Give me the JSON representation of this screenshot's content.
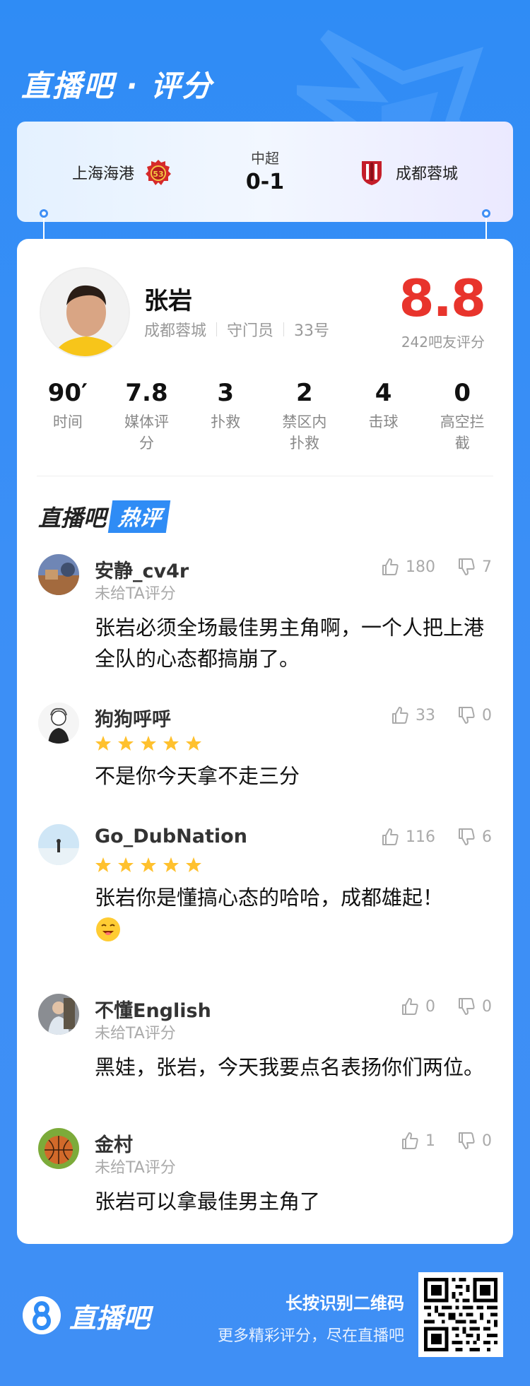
{
  "brand_title": "直播吧 · 评分",
  "match": {
    "home_team": "上海海港",
    "league": "中超",
    "score": "0-1",
    "away_team": "成都蓉城"
  },
  "player": {
    "name": "张岩",
    "team": "成都蓉城",
    "position": "守门员",
    "number": "33号",
    "rating": "8.8",
    "rating_count": "242吧友评分"
  },
  "stats": [
    {
      "value": "90′",
      "label": "时间"
    },
    {
      "value": "7.8",
      "label": "媒体评分"
    },
    {
      "value": "3",
      "label": "扑救"
    },
    {
      "value": "2",
      "label": "禁区内扑救"
    },
    {
      "value": "4",
      "label": "击球"
    },
    {
      "value": "0",
      "label": "高空拦截"
    }
  ],
  "hot_comments_title": {
    "part1": "直播吧",
    "part2": "热评"
  },
  "comments": [
    {
      "user": "安静_cv4r",
      "sub": "未给TA评分",
      "stars": 0,
      "likes": "180",
      "dislikes": "7",
      "text": "张岩必须全场最佳男主角啊，一个人把上港全队的心态都搞崩了。"
    },
    {
      "user": "狗狗呼呼",
      "sub": "",
      "stars": 5,
      "likes": "33",
      "dislikes": "0",
      "text": "不是你今天拿不走三分"
    },
    {
      "user": "Go_DubNation",
      "sub": "",
      "stars": 5,
      "likes": "116",
      "dislikes": "6",
      "text": "张岩你是懂搞心态的哈哈，成都雄起！"
    },
    {
      "user": "不懂English",
      "sub": "未给TA评分",
      "stars": 0,
      "likes": "0",
      "dislikes": "0",
      "text": "黑娃，张岩，今天我要点名表扬你们两位。"
    },
    {
      "user": "金村",
      "sub": "未给TA评分",
      "stars": 0,
      "likes": "1",
      "dislikes": "0",
      "text": "张岩可以拿最佳男主角了"
    }
  ],
  "footer": {
    "logo_text": "直播吧",
    "line1": "长按识别二维码",
    "line2": "更多精彩评分，尽在直播吧"
  },
  "colors": {
    "accent": "#2f8cf5",
    "rating": "#e8342c",
    "star": "#ffc12e"
  }
}
